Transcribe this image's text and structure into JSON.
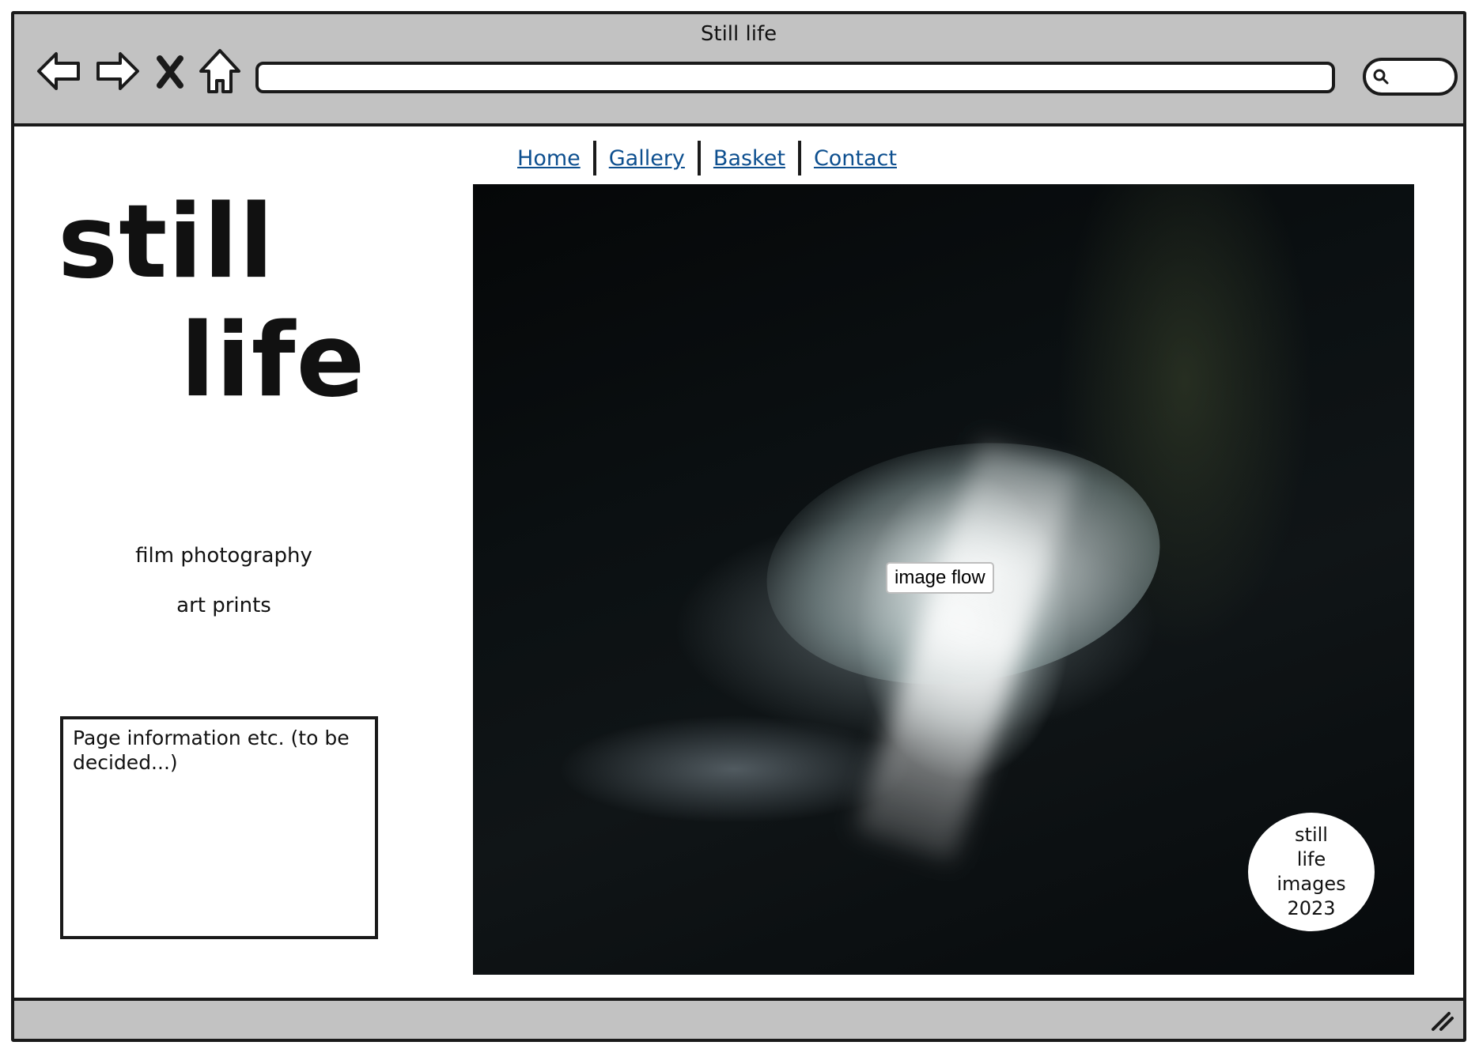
{
  "window": {
    "title": "Still life"
  },
  "toolbar": {
    "back_icon": "back-arrow-icon",
    "forward_icon": "forward-arrow-icon",
    "stop_icon": "close-icon",
    "home_icon": "home-icon",
    "url_value": "",
    "search_value": "",
    "search_icon": "search-icon"
  },
  "nav": {
    "items": [
      {
        "label": "Home"
      },
      {
        "label": "Gallery"
      },
      {
        "label": "Basket"
      },
      {
        "label": "Contact"
      }
    ],
    "link_color": "#0d4f8f"
  },
  "brand": {
    "line1": "still",
    "line2": "life"
  },
  "sidebar": {
    "tagline1": "film photography",
    "tagline2": "art prints",
    "info_text": "Page information etc. (to be decided...)"
  },
  "main": {
    "image_button_label": "image flow",
    "badge_lines": [
      "still",
      "life",
      "images",
      "2023"
    ]
  },
  "statusbar": {
    "resize_icon": "resize-grip-icon"
  }
}
